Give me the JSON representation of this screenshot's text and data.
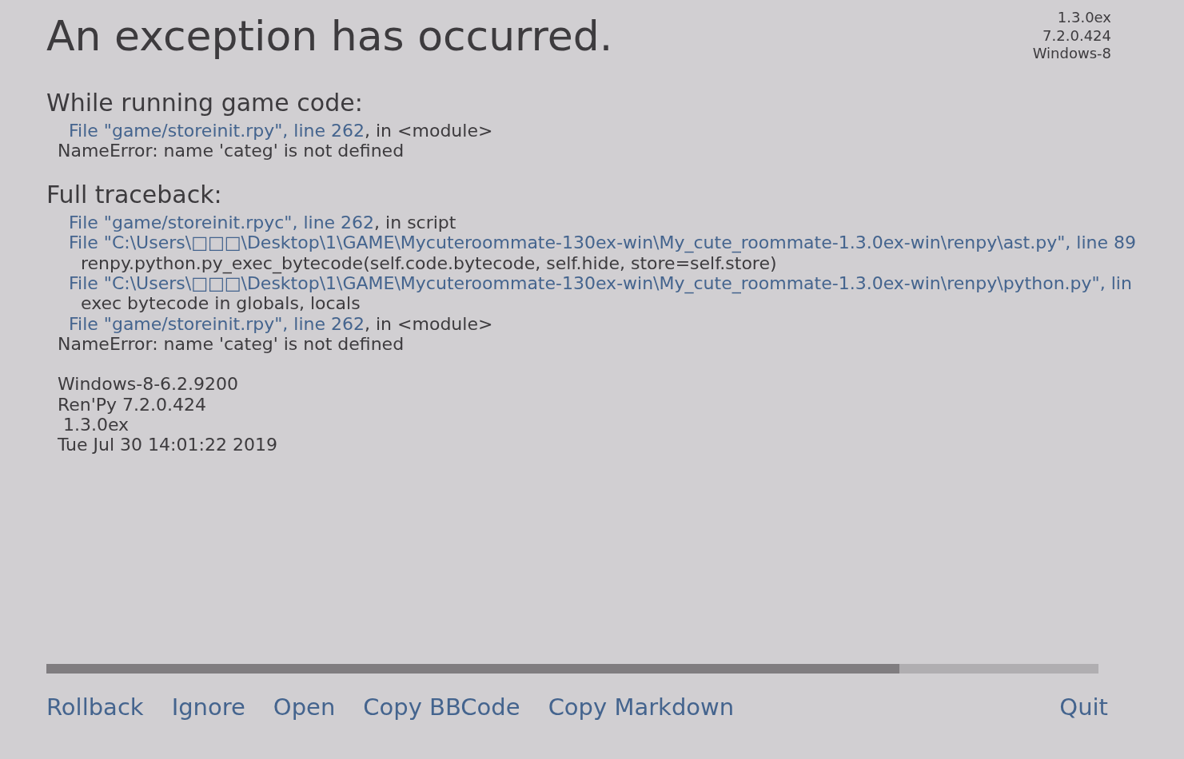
{
  "title": "An exception has occurred.",
  "versions": [
    "1.3.0ex",
    "7.2.0.424",
    "Windows-8"
  ],
  "sections": [
    {
      "heading": "While running game code:",
      "lines": [
        {
          "kind": "file",
          "link": "File \"game/storeinit.rpy\", line 262",
          "text": ", in <module>"
        },
        {
          "kind": "error",
          "text": "NameError: name 'categ' is not defined"
        }
      ]
    },
    {
      "heading": "Full traceback:",
      "lines": [
        {
          "kind": "file",
          "link": "File \"game/storeinit.rpyc\", line 262",
          "text": ", in script"
        },
        {
          "kind": "file",
          "link": "File \"C:\\Users\\□□□\\Desktop\\1\\GAME\\Mycuteroommate-130ex-win\\My_cute_roommate-1.3.0ex-win\\renpy\\ast.py\", line 89"
        },
        {
          "kind": "code",
          "text": "renpy.python.py_exec_bytecode(self.code.bytecode, self.hide, store=self.store)"
        },
        {
          "kind": "file",
          "link": "File \"C:\\Users\\□□□\\Desktop\\1\\GAME\\Mycuteroommate-130ex-win\\My_cute_roommate-1.3.0ex-win\\renpy\\python.py\", lin"
        },
        {
          "kind": "code",
          "text": "exec bytecode in globals, locals"
        },
        {
          "kind": "file",
          "link": "File \"game/storeinit.rpy\", line 262",
          "text": ", in <module>"
        },
        {
          "kind": "error",
          "text": "NameError: name 'categ' is not defined"
        }
      ]
    }
  ],
  "system_info": [
    "Windows-8-6.2.9200",
    "Ren'Py 7.2.0.424",
    " 1.3.0ex",
    "Tue Jul 30 14:01:22 2019"
  ],
  "actions": {
    "left": [
      "Rollback",
      "Ignore",
      "Open",
      "Copy BBCode",
      "Copy Markdown"
    ],
    "right": [
      "Quit"
    ]
  }
}
